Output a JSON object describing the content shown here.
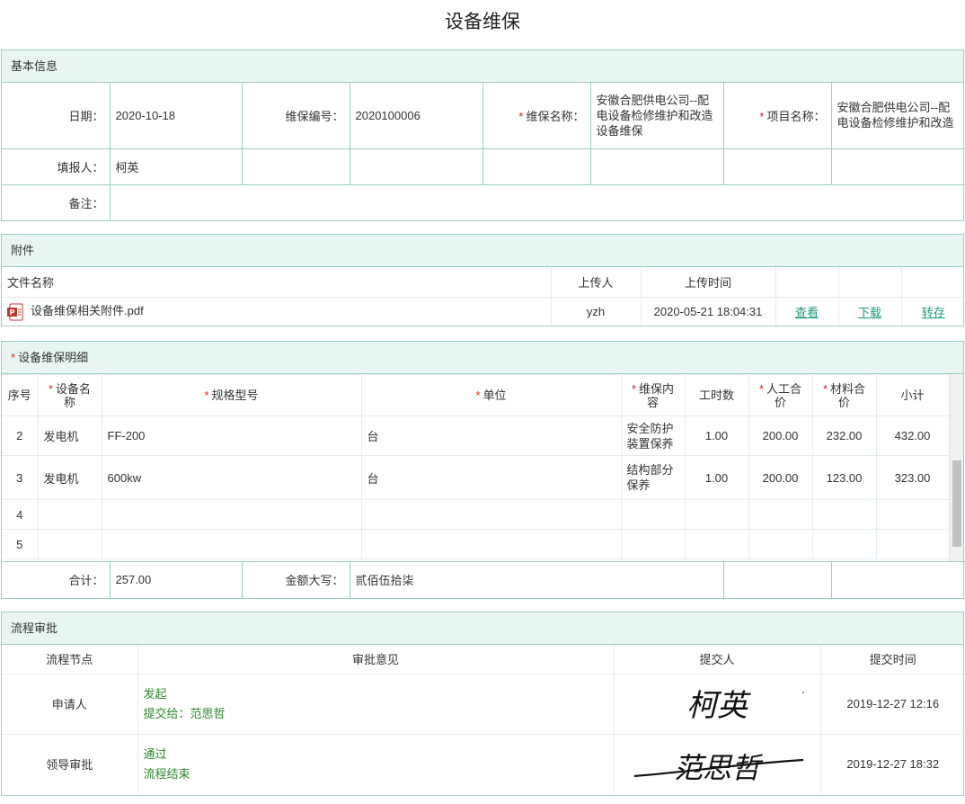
{
  "page_title": "设备维保",
  "basic": {
    "header": "基本信息",
    "date_label": "日期：",
    "date_value": "2020-10-18",
    "code_label": "维保编号：",
    "code_value": "2020100006",
    "name_label": "维保名称：",
    "name_value": "安徽合肥供电公司--配电设备检修维护和改造设备维保",
    "project_label": "项目名称：",
    "project_value": "安徽合肥供电公司--配电设备检修维护和改造",
    "reporter_label": "填报人：",
    "reporter_value": "柯英",
    "remark_label": "备注："
  },
  "attachments": {
    "header": "附件",
    "col_file": "文件名称",
    "col_uploader": "上传人",
    "col_time": "上传时间",
    "file": {
      "name": "设备维保相关附件.pdf",
      "uploader": "yzh",
      "time": "2020-05-21 18:04:31",
      "view": "查看",
      "download": "下载",
      "transfer": "转存"
    }
  },
  "details": {
    "header": "设备维保明细",
    "columns": [
      "序号",
      "设备名称",
      "规格型号",
      "单位",
      "维保内容",
      "工时数",
      "人工合价",
      "材料合价",
      "小计"
    ],
    "rows": [
      {
        "no": "2",
        "device": "发电机",
        "model": "FF-200",
        "unit": "台",
        "content": "安全防护装置保养",
        "hours": "1.00",
        "labor": "200.00",
        "material": "232.00",
        "subtotal": "432.00"
      },
      {
        "no": "3",
        "device": "发电机",
        "model": "600kw",
        "unit": "台",
        "content": "结构部分保养",
        "hours": "1.00",
        "labor": "200.00",
        "material": "123.00",
        "subtotal": "323.00"
      },
      {
        "no": "4"
      },
      {
        "no": "5"
      }
    ],
    "total_label": "合计：",
    "total_value": "257.00",
    "amount_label": "金额大写：",
    "amount_value": "贰佰伍拾柒"
  },
  "flow": {
    "header": "流程审批",
    "col_node": "流程节点",
    "col_opinion": "审批意见",
    "col_submitter": "提交人",
    "col_time": "提交时间",
    "rows": [
      {
        "node": "申请人",
        "line1": "发起",
        "line2": "提交给：范思哲",
        "signature": "柯英",
        "time": "2019-12-27 12:16"
      },
      {
        "node": "领导审批",
        "line1": "通过",
        "line2": "流程结束",
        "signature": "范思哲",
        "time": "2019-12-27 18:32"
      }
    ]
  },
  "colors": {
    "border": "#9ccfc4",
    "header_bg": "#e8f5f2",
    "link": "#1a9c7e",
    "required": "#e02020",
    "flow_text": "#2b8a2b"
  }
}
